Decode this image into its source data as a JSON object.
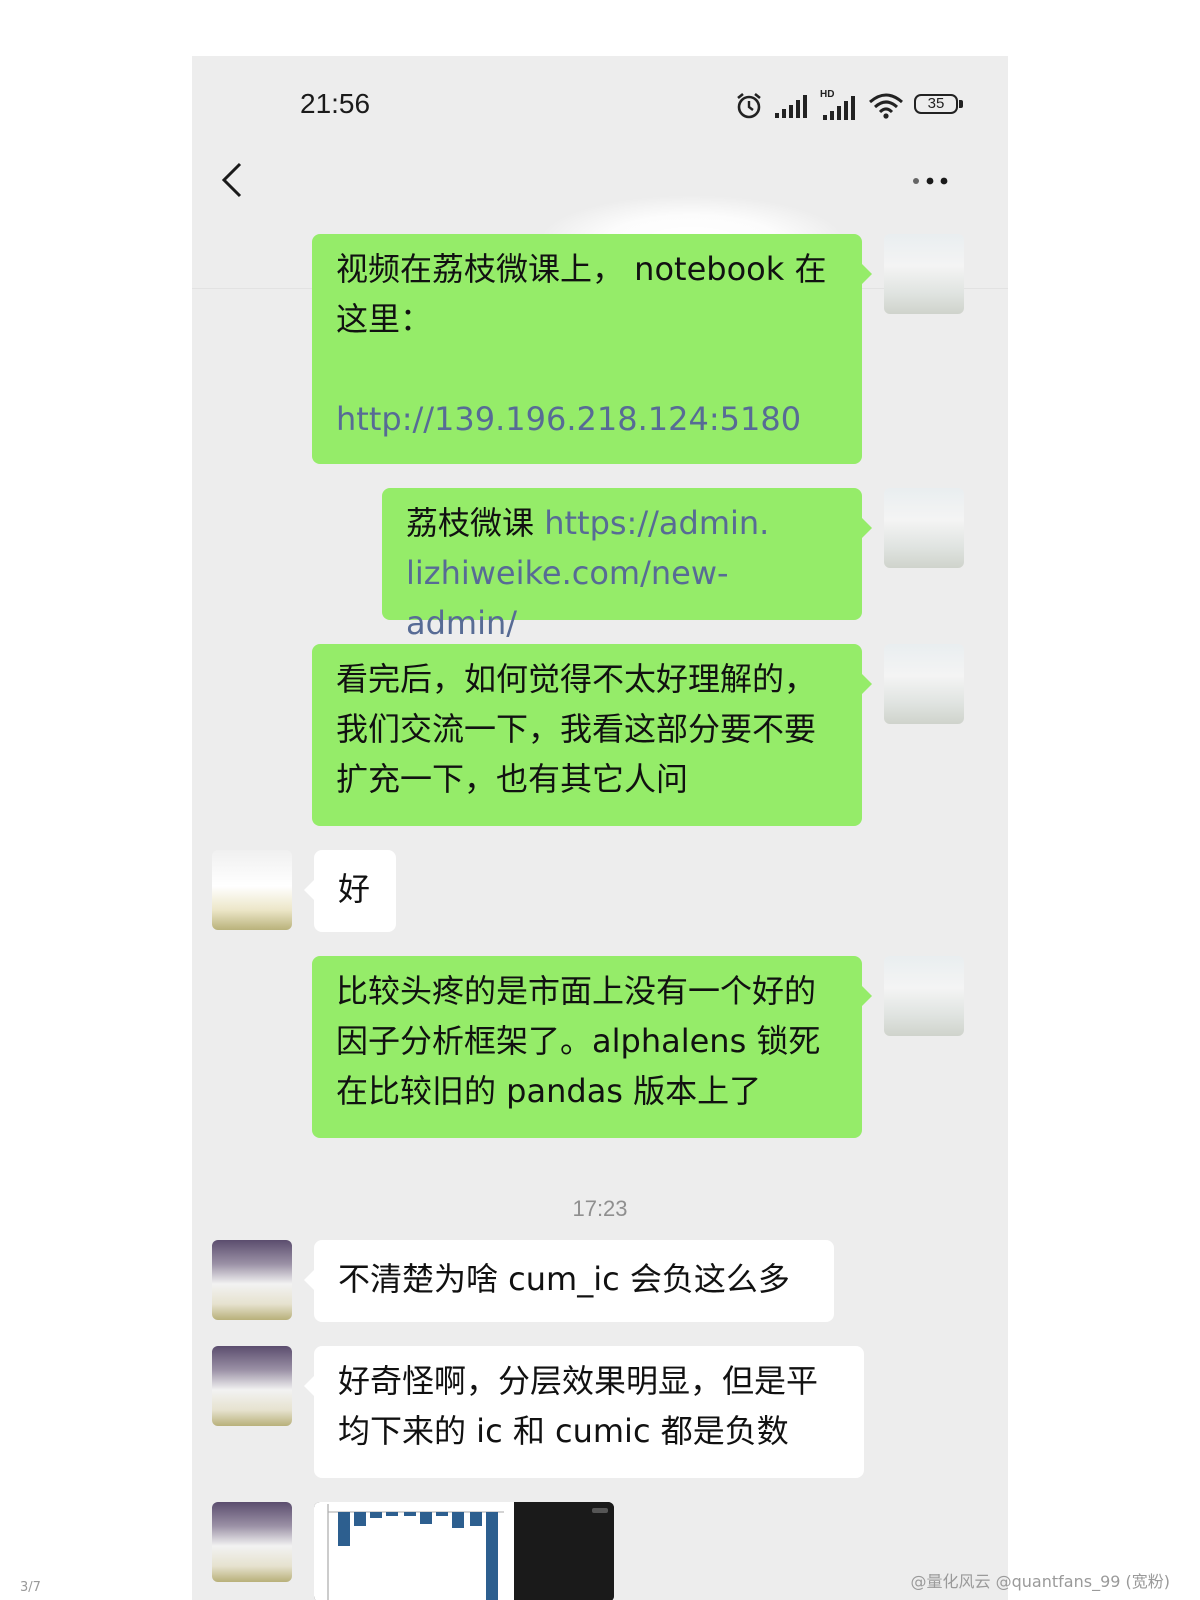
{
  "statusbar": {
    "time": "21:56",
    "battery": "35",
    "network_badge": "HD",
    "icons": [
      "alarm-icon",
      "signal-icon",
      "hd-signal-icon",
      "wifi-icon",
      "battery-icon"
    ]
  },
  "chat": {
    "messages": [
      {
        "side": "me",
        "lines": [
          "视频在荔枝微课上， notebook 在",
          "这里："
        ],
        "link_line": "http://139.196.218.124:5180"
      },
      {
        "side": "me",
        "prefix": "荔枝微课 ",
        "link1": "https://admin.",
        "link2": "lizhiweike.com/new-admin/"
      },
      {
        "side": "me",
        "lines": [
          "看完后，如何觉得不太好理解的，",
          "我们交流一下，我看这部分要不要",
          "扩充一下，也有其它人问"
        ]
      },
      {
        "side": "them",
        "lines": [
          "好"
        ]
      },
      {
        "side": "me",
        "lines": [
          "比较头疼的是市面上没有一个好的",
          "因子分析框架了。alphalens 锁死",
          "在比较旧的 pandas 版本上了"
        ]
      },
      {
        "side": "them",
        "lines": [
          "不清楚为啥 cum_ic 会负这么多"
        ]
      },
      {
        "side": "them",
        "lines": [
          "好奇怪啊，分层效果明显，但是平",
          "均下来的 ic 和 cumic 都是负数"
        ]
      }
    ],
    "timestamp": "17:23"
  },
  "footer": {
    "page_indicator": "3/7",
    "watermark": "@量化风云 @quantfans_99 (宽粉)"
  },
  "colors": {
    "my_bubble": "#95ec69",
    "their_bubble": "#ffffff",
    "link": "#576b95",
    "background": "#ededed"
  }
}
